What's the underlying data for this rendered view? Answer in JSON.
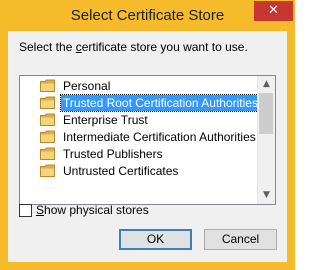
{
  "window": {
    "title": "Select Certificate Store",
    "close_glyph": "✕",
    "frame_color": "#f5bb2a",
    "close_color": "#c7372f"
  },
  "dialog": {
    "instruction_pre": "Select the ",
    "instruction_accel": "c",
    "instruction_post": "ertificate store you want to use."
  },
  "store_list": {
    "selected_index": 1,
    "items": [
      {
        "label": "Personal",
        "icon": "folder-icon"
      },
      {
        "label": "Trusted Root Certification Authorities",
        "icon": "folder-icon"
      },
      {
        "label": "Enterprise Trust",
        "icon": "folder-icon"
      },
      {
        "label": "Intermediate Certification Authorities",
        "icon": "folder-icon"
      },
      {
        "label": "Trusted Publishers",
        "icon": "folder-icon"
      },
      {
        "label": "Untrusted Certificates",
        "icon": "folder-icon"
      }
    ],
    "scroll_up_glyph": "▲",
    "scroll_down_glyph": "▼",
    "selection_color": "#3399ff"
  },
  "options": {
    "show_physical_accel": "S",
    "show_physical_rest": "how physical stores",
    "show_physical_checked": false
  },
  "buttons": {
    "ok_label": "OK",
    "cancel_label": "Cancel"
  }
}
